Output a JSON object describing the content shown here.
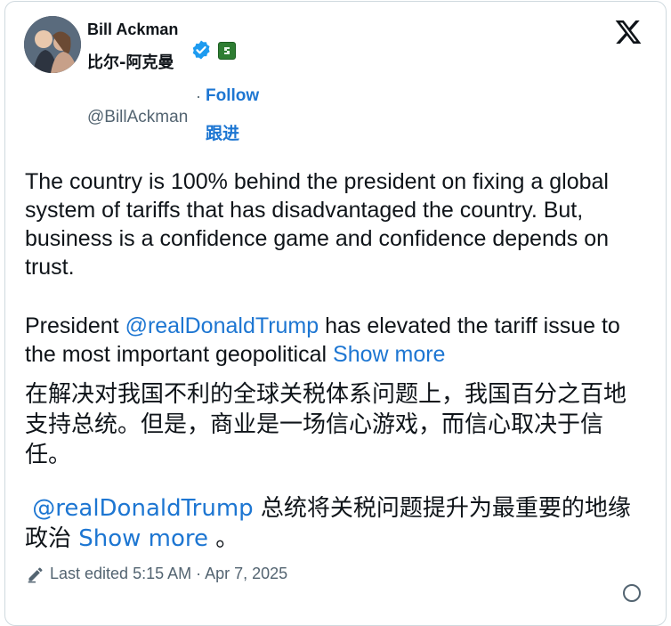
{
  "author": {
    "display_name": "Bill Ackman",
    "display_name_zh": "比尔-阿克曼",
    "handle": "@BillAckman",
    "follow_label": "Follow",
    "follow_label_zh": "跟进",
    "separator": "·"
  },
  "post": {
    "p1": "The country is 100% behind the president on fixing a global system of tariffs that has disadvantaged the country. But, business is a confidence game and confidence depends on trust.",
    "p2_prefix": "President ",
    "p2_mention": "@realDonaldTrump",
    "p2_suffix": " has elevated the tariff issue to the most important geopolitical ",
    "show_more": "Show more",
    "p3_zh": "在解决对我国不利的全球关税体系问题上，我国百分之百地支持总统。但是，商业是一场信心游戏，而信心取决于信任。",
    "p4_mention": "@realDonaldTrump",
    "p4_zh": " 总统将关税问题提升为最重要的地缘政治 ",
    "show_more_zh": "Show more",
    "p4_end": " 。"
  },
  "footer": {
    "edited_text": "Last edited 5:15 AM · Apr 7, 2025"
  },
  "icons": {
    "verified": "verified-badge-icon",
    "affiliate": "affiliate-badge-icon",
    "x_logo": "x-logo-icon",
    "edit": "pencil-icon"
  },
  "colors": {
    "link": "#1d76d2",
    "verified": "#1d9bf0",
    "secondary_text": "#536471"
  }
}
